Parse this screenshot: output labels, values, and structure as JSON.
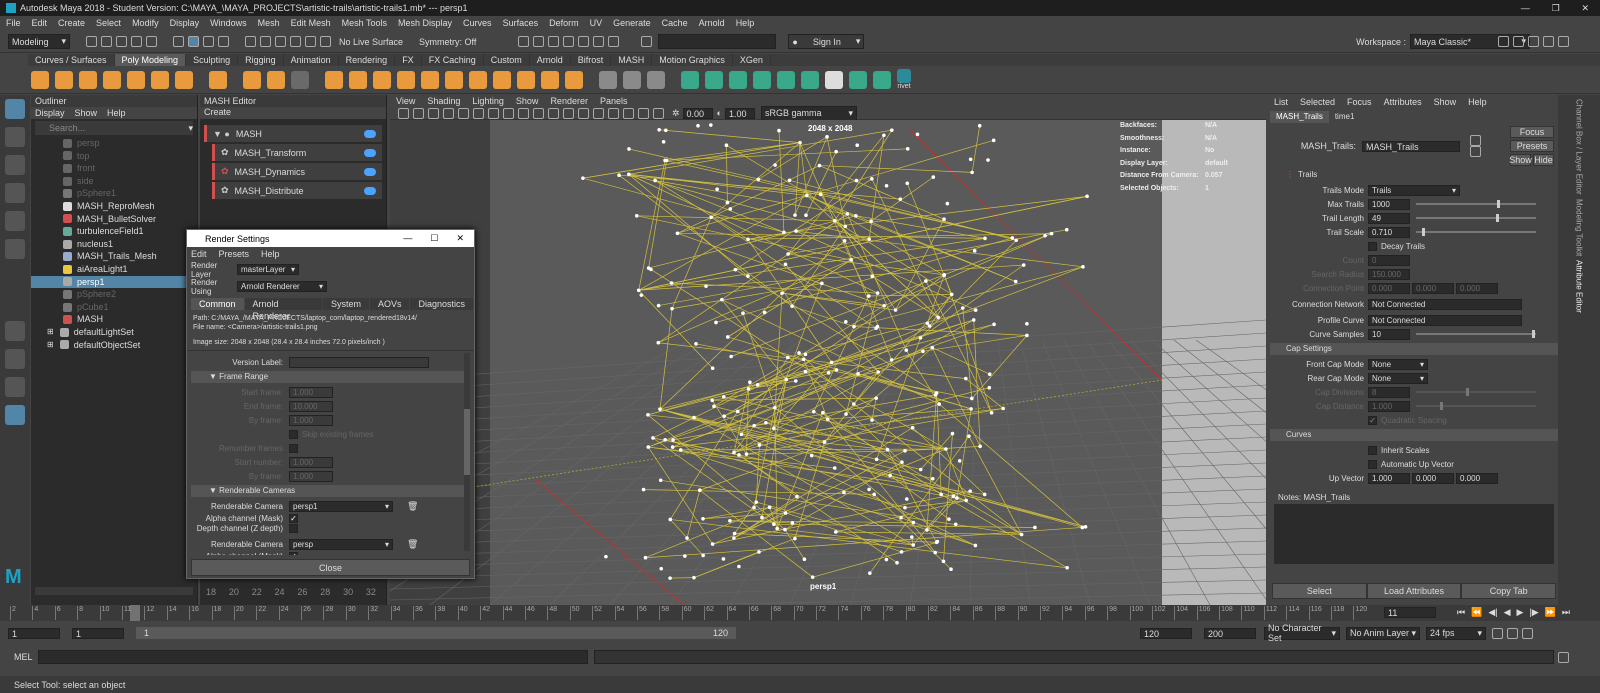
{
  "app": {
    "title": "Autodesk Maya 2018 - Student Version: C:\\MAYA_\\MAYA_PROJECTS\\artistic-trails\\artistic-trails1.mb*  ---  persp1"
  },
  "menubar": [
    "File",
    "Edit",
    "Create",
    "Select",
    "Modify",
    "Display",
    "Windows",
    "Mesh",
    "Edit Mesh",
    "Mesh Tools",
    "Mesh Display",
    "Curves",
    "Surfaces",
    "Deform",
    "UV",
    "Generate",
    "Cache",
    "Arnold",
    "Help"
  ],
  "workspace": {
    "label": "Workspace :",
    "value": "Maya Classic*"
  },
  "status": {
    "mode": "Modeling",
    "live_surface": "No Live Surface",
    "symmetry": "Symmetry: Off",
    "signin": "Sign In"
  },
  "shelf_tabs": [
    "Curves / Surfaces",
    "Poly Modeling",
    "Sculpting",
    "Rigging",
    "Animation",
    "Rendering",
    "FX",
    "FX Caching",
    "Custom",
    "Arnold",
    "Bifrost",
    "MASH",
    "Motion Graphics",
    "XGen"
  ],
  "shelf_active": "Poly Modeling",
  "shelf_label": "rivet",
  "outliner": {
    "title": "Outliner",
    "menu": [
      "Display",
      "Show",
      "Help"
    ],
    "search": "Search...",
    "items": [
      {
        "name": "persp",
        "dim": true,
        "color": "#666"
      },
      {
        "name": "top",
        "dim": true,
        "color": "#666"
      },
      {
        "name": "front",
        "dim": true,
        "color": "#666"
      },
      {
        "name": "side",
        "dim": true,
        "color": "#666"
      },
      {
        "name": "pSphere1",
        "dim": true,
        "color": "#777"
      },
      {
        "name": "MASH_ReproMesh",
        "color": "#ddd"
      },
      {
        "name": "MASH_BulletSolver",
        "color": "#d05050"
      },
      {
        "name": "turbulenceField1",
        "color": "#6a9"
      },
      {
        "name": "nucleus1",
        "color": "#aaa"
      },
      {
        "name": "MASH_Trails_Mesh",
        "color": "#9ac"
      },
      {
        "name": "aiAreaLight1",
        "color": "#e8c840"
      },
      {
        "name": "persp1",
        "selected": true,
        "color": "#aaa"
      },
      {
        "name": "pSphere2",
        "dim": true,
        "color": "#777"
      },
      {
        "name": "pCube1",
        "dim": true,
        "color": "#777"
      },
      {
        "name": "MASH",
        "color": "#d05050"
      },
      {
        "name": "defaultLightSet",
        "color": "#aaa"
      },
      {
        "name": "defaultObjectSet",
        "color": "#aaa"
      }
    ]
  },
  "mash_editor": {
    "title": "MASH Editor",
    "menu": "Create",
    "nodes": [
      "MASH",
      "MASH_Transform",
      "MASH_Dynamics",
      "MASH_Distribute"
    ]
  },
  "viewport": {
    "menu": [
      "View",
      "Shading",
      "Lighting",
      "Show",
      "Renderer",
      "Panels"
    ],
    "val1": "0.00",
    "val2": "1.00",
    "colorspace": "sRGB gamma",
    "resolution": "2048 x 2048",
    "camera": "persp1",
    "hud": [
      [
        "Backfaces:",
        "N/A"
      ],
      [
        "Smoothness:",
        "N/A"
      ],
      [
        "Instance:",
        "No"
      ],
      [
        "Display Layer:",
        "default"
      ],
      [
        "Distance From Camera:",
        "0.057"
      ],
      [
        "Selected Objects:",
        "1"
      ]
    ]
  },
  "render_settings": {
    "title": "Render Settings",
    "menu": [
      "Edit",
      "Presets",
      "Help"
    ],
    "render_layer_label": "Render Layer",
    "render_layer": "masterLayer",
    "render_using_label": "Render Using",
    "render_using": "Arnold Renderer",
    "tabs": [
      "Common",
      "Arnold Renderer",
      "System",
      "AOVs",
      "Diagnostics"
    ],
    "path": "Path: C:/MAYA_/MAYA_PROJECTS/laptop_com/laptop_rendered18v14/",
    "filename": "File name:  <Camera>/artistic-trails1.png",
    "imagesize": "Image size: 2048 x 2048 (28.4 x 28.4 inches 72.0 pixels/inch )",
    "version_label": "Version Label:",
    "frame_range": "Frame Range",
    "frame_fields": [
      [
        "Start frame:",
        "1.000"
      ],
      [
        "End frame:",
        "10.000"
      ],
      [
        "By frame:",
        "1.000"
      ]
    ],
    "skip": "Skip existing frames",
    "renumber": "Renumber frames",
    "renum_fields": [
      [
        "Start number:",
        "1.000"
      ],
      [
        "By frame:",
        "1.000"
      ]
    ],
    "renderable": "Renderable Cameras",
    "cam_label": "Renderable Camera",
    "cam1": "persp1",
    "cam2": "persp",
    "alpha": "Alpha channel (Mask)",
    "depth": "Depth channel (Z depth)",
    "close": "Close"
  },
  "attr": {
    "menu": [
      "List",
      "Selected",
      "Focus",
      "Attributes",
      "Show",
      "Help"
    ],
    "tabs": [
      "MASH_Trails",
      "time1"
    ],
    "node_label": "MASH_Trails:",
    "node": "MASH_Trails",
    "focus": "Focus",
    "presets": "Presets",
    "show": "Show",
    "hide": "Hide",
    "trails": "Trails",
    "trails_mode_label": "Trails Mode",
    "trails_mode": "Trails",
    "max_trails_label": "Max Trails",
    "max_trails": "1000",
    "max_trails_frac": 0.7,
    "trail_length_label": "Trail Length",
    "trail_length": "49",
    "trail_length_frac": 0.69,
    "trail_scale_label": "Trail Scale",
    "trail_scale": "0.710",
    "trail_scale_frac": 0.05,
    "decay": "Decay Trails",
    "count_label": "Count",
    "count": "0",
    "search_label": "Search Radius",
    "search": "150.000",
    "conn_label": "Connection Point",
    "conn": [
      "0.000",
      "0.000",
      "0.000"
    ],
    "network_label": "Connection Network",
    "network": "Not Connected",
    "profile_label": "Profile Curve",
    "profile": "Not Connected",
    "samples_label": "Curve Samples",
    "samples": "10",
    "cap": "Cap Settings",
    "front_label": "Front Cap Mode",
    "front": "None",
    "rear_label": "Rear Cap Mode",
    "rear": "None",
    "divisions_label": "Cap Divisions",
    "divisions": "8",
    "distance_label": "Cap Distance",
    "distance": "1.000",
    "quad": "Quadratic Spacing",
    "curves": "Curves",
    "inherit": "Inherit Scales",
    "autoup": "Automatic Up Vector",
    "upvec_label": "Up Vector",
    "upvec": [
      "1.000",
      "0.000",
      "0.000"
    ],
    "notes": "Notes:  MASH_Trails",
    "buttons": [
      "Select",
      "Load Attributes",
      "Copy Tab"
    ]
  },
  "right_strip": [
    "Channel Box / Layer Editor",
    "Modeling Toolkit",
    "Attribute Editor"
  ],
  "timeline": {
    "ticks": [
      "2",
      "4",
      "6",
      "8",
      "10",
      "11",
      "12",
      "14",
      "16",
      "18",
      "20",
      "22",
      "24",
      "26",
      "28",
      "30",
      "32",
      "34",
      "36",
      "38",
      "40",
      "42",
      "44",
      "46",
      "48",
      "50",
      "52",
      "54",
      "56",
      "58",
      "60",
      "62",
      "64",
      "66",
      "68",
      "70",
      "72",
      "74",
      "76",
      "78",
      "80",
      "82",
      "84",
      "86",
      "88",
      "90",
      "92",
      "94",
      "96",
      "98",
      "100",
      "102",
      "104",
      "106",
      "108",
      "110",
      "112",
      "114",
      "116",
      "118",
      "120"
    ],
    "current": "11",
    "mash_ticks": [
      "18",
      "20",
      "22",
      "24",
      "26",
      "28",
      "30",
      "32"
    ]
  },
  "range": {
    "start": "1",
    "start2": "1",
    "rstart": "1",
    "rend": "120",
    "end": "120",
    "end2": "200",
    "charset": "No Character Set",
    "animlayer": "No Anim Layer",
    "fps": "24 fps"
  },
  "cmd": {
    "label": "MEL"
  },
  "help": "Select Tool: select an object"
}
